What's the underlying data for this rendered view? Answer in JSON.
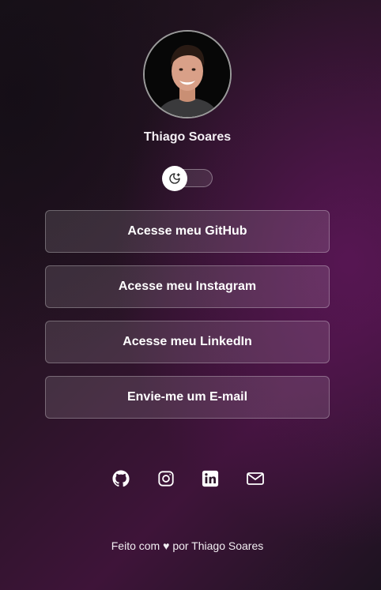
{
  "profile": {
    "name": "Thiago Soares"
  },
  "theme_toggle": {
    "icon": "moon-stars-icon",
    "state": "dark"
  },
  "links": [
    {
      "label": "Acesse meu GitHub"
    },
    {
      "label": "Acesse meu Instagram"
    },
    {
      "label": "Acesse meu LinkedIn"
    },
    {
      "label": "Envie-me um E-mail"
    }
  ],
  "social_icons": [
    "github-icon",
    "instagram-icon",
    "linkedin-icon",
    "mail-icon"
  ],
  "footer": {
    "prefix": "Feito com",
    "heart": "♥",
    "suffix": "por Thiago Soares"
  },
  "colors": {
    "background_dark": "#1a1219",
    "background_accent": "#5c1658",
    "text": "#ffffff"
  }
}
